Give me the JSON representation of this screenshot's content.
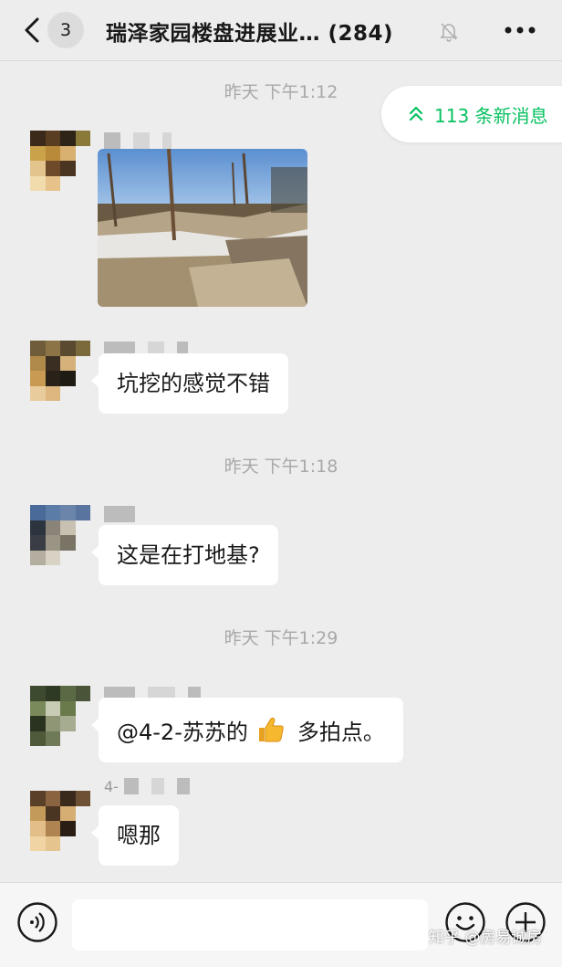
{
  "header": {
    "unread_count": "3",
    "title": "瑞泽家园楼盘进展业… (284)",
    "mute_icon": "bell-slash-icon",
    "more_icon": "ellipsis-icon"
  },
  "new_messages_pill": {
    "label": "113 条新消息",
    "icon": "double-chevron-up-icon",
    "color": "#07c160"
  },
  "messages": [
    {
      "type": "timestamp",
      "text": "昨天 下午1:12"
    },
    {
      "type": "image",
      "description_icon": "photo-message"
    },
    {
      "type": "text",
      "text": "坑挖的感觉不错"
    },
    {
      "type": "timestamp",
      "text": "昨天 下午1:18"
    },
    {
      "type": "text",
      "text": "这是在打地基?"
    },
    {
      "type": "timestamp",
      "text": "昨天 下午1:29"
    },
    {
      "type": "text",
      "text_before": "@4-2-苏苏的",
      "emoji": "thumbs-up-icon",
      "text_after": "多拍点。"
    },
    {
      "type": "text",
      "name_prefix": "4-",
      "text": "嗯那"
    }
  ],
  "input_bar": {
    "placeholder": "",
    "voice_icon": "voice-icon",
    "emoji_icon": "smiley-icon",
    "plus_icon": "plus-circle-icon"
  },
  "watermark": "知乎 @房易诚房"
}
